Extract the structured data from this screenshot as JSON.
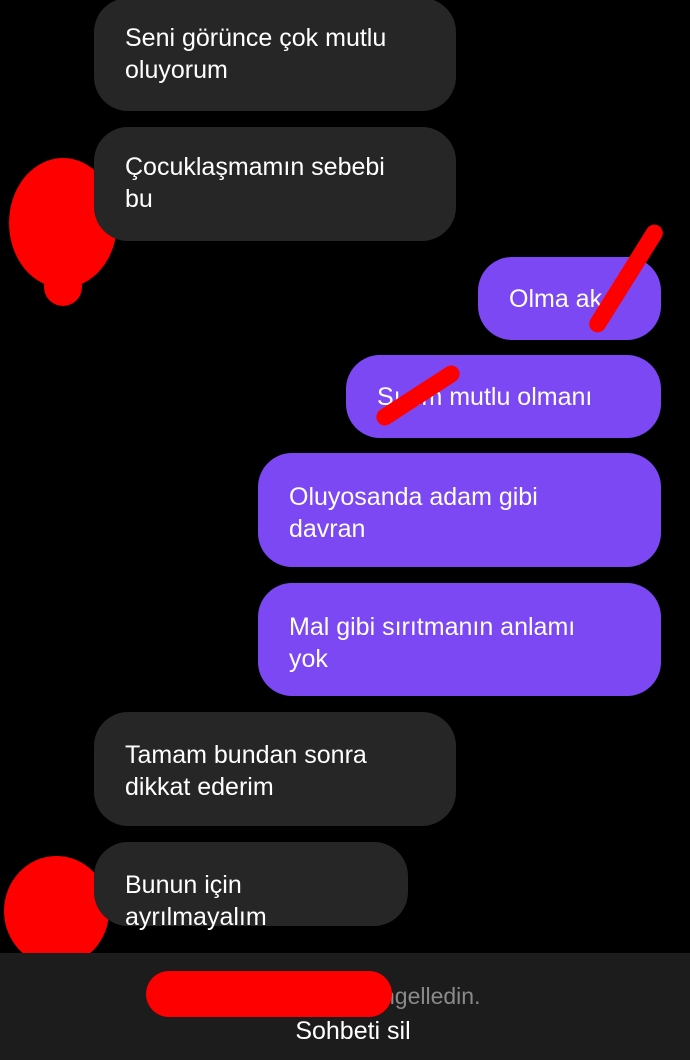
{
  "conversation": {
    "messages": [
      {
        "direction": "incoming",
        "text": "Seni görünce çok mutlu\noluyorum"
      },
      {
        "direction": "incoming",
        "text": "Çocuklaşmamın sebebi\nbu"
      },
      {
        "direction": "outgoing",
        "text": "Olma ak"
      },
      {
        "direction": "outgoing",
        "text": "Sı rim mutlu olmanı"
      },
      {
        "direction": "outgoing",
        "text": "Oluyosanda adam gibi\ndavran"
      },
      {
        "direction": "outgoing",
        "text": "Mal gibi sırıtmanın anlamı\nyok"
      },
      {
        "direction": "incoming",
        "text": "Tamam bundan sonra\ndikkat ederim"
      },
      {
        "direction": "incoming",
        "text": "Bunun için ayrılmayalım"
      }
    ]
  },
  "footer": {
    "notice_text": "ngelledin.",
    "delete_chat_label": "Sohbeti sil"
  },
  "colors": {
    "background": "#000000",
    "incoming_bubble": "#262626",
    "outgoing_bubble": "#7c48f4",
    "redaction": "#ff0000",
    "footer_bg": "#1c1c1c",
    "notice_text": "#8a8a8a"
  }
}
